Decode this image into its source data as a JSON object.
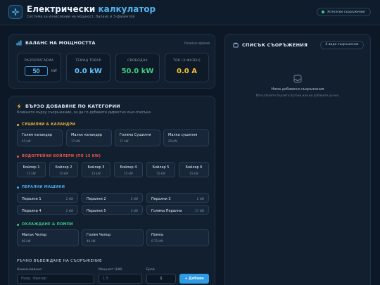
{
  "header": {
    "title_main": "Електрически ",
    "title_accent": "калкулатор",
    "subtitle": "Система за изчисление на мощност, баланс и 3-фазентов",
    "status": "Хотелски съоръжения"
  },
  "balance": {
    "title": "БАЛАНС НА МОЩНОСТТА",
    "realtime": "Реално време",
    "capacity": {
      "label": "РАЗПОЛАГАЕМА",
      "value": "50",
      "unit": "kW"
    },
    "load": {
      "label": "ТЕКУЩ ТОВАР",
      "value": "0.0 kW"
    },
    "free": {
      "label": "СВОБОДНА",
      "value": "50.0 kW"
    },
    "current": {
      "label": "ТОК (3-ФАЗЕН)",
      "value": "0.0 A"
    }
  },
  "quick_add": {
    "title": "БЪРЗО ДОБАВЯНЕ ПО КАТЕГОРИИ",
    "subtitle": "Кликнете върху съоръжение, за да го добавите директно към списъка",
    "categories": [
      {
        "name": "СУШИЛНИ & КАЛАНДРИ",
        "color": "#f0b43a",
        "items": [
          {
            "name": "Голям каландер",
            "kw": "45 kW"
          },
          {
            "name": "Малък каландер",
            "kw": "17 kW"
          },
          {
            "name": "Голяма Сушилня",
            "kw": "27 kW"
          },
          {
            "name": "Малка сушилня",
            "kw": "20 kW"
          }
        ]
      },
      {
        "name": "ВОДОГРЕЙНИ БОЙЛЕРИ (ПО 15 KW)",
        "color": "#e8564a",
        "items": [
          {
            "name": "Бойлер 1",
            "kw": "15 kW"
          },
          {
            "name": "Бойлер 2",
            "kw": "15 kW"
          },
          {
            "name": "Бойлер 3",
            "kw": "15 kW"
          },
          {
            "name": "Бойлер 4",
            "kw": "15 kW"
          },
          {
            "name": "Бойлер 5",
            "kw": "15 kW"
          },
          {
            "name": "Бойлер 6",
            "kw": "15 kW"
          }
        ]
      },
      {
        "name": "ПЕРАЛНИ МАШИНИ",
        "color": "#4aa8ec",
        "items": [
          {
            "name": "Перални 1",
            "kw": "2 kW"
          },
          {
            "name": "Перални 2",
            "kw": "2 kW"
          },
          {
            "name": "Перални 3",
            "kw": "2 kW"
          },
          {
            "name": "Перални 4",
            "kw": "2 kW"
          },
          {
            "name": "Перални 5",
            "kw": "2 kW"
          },
          {
            "name": "Голяма Перални",
            "kw": "17 kW"
          }
        ]
      },
      {
        "name": "ОХЛАЖДАНЕ & ПОМПИ",
        "color": "#3cc88a",
        "items": [
          {
            "name": "Малък Чилър",
            "kw": "80 kW"
          },
          {
            "name": "Голям Чилър",
            "kw": "40 kW"
          },
          {
            "name": "Помпа",
            "kw": "0.75 kW"
          }
        ]
      }
    ]
  },
  "manual": {
    "title": "РЪЧНО ВЪВЕЖДАНЕ НА СЪОРЪЖЕНИЕ",
    "name_label": "Наименование",
    "name_placeholder": "Напр. Фризер",
    "power_label": "Мощност (kW)",
    "power_placeholder": "1.5",
    "qty_label": "Брой",
    "qty_value": "1",
    "add_label": "+ Добави"
  },
  "list": {
    "title": "СПИСЪК СЪОРЪЖЕНИЯ",
    "badge": "0 вида съоръжения",
    "empty_title": "Няма добавени съоръжения",
    "empty_sub": "Използвайте бързите бутони или ви добавите ръчно."
  },
  "colors": {
    "accent": "#52b4ec",
    "load": "#62c2ff",
    "free": "#3cd07f",
    "current": "#f0c03a"
  }
}
